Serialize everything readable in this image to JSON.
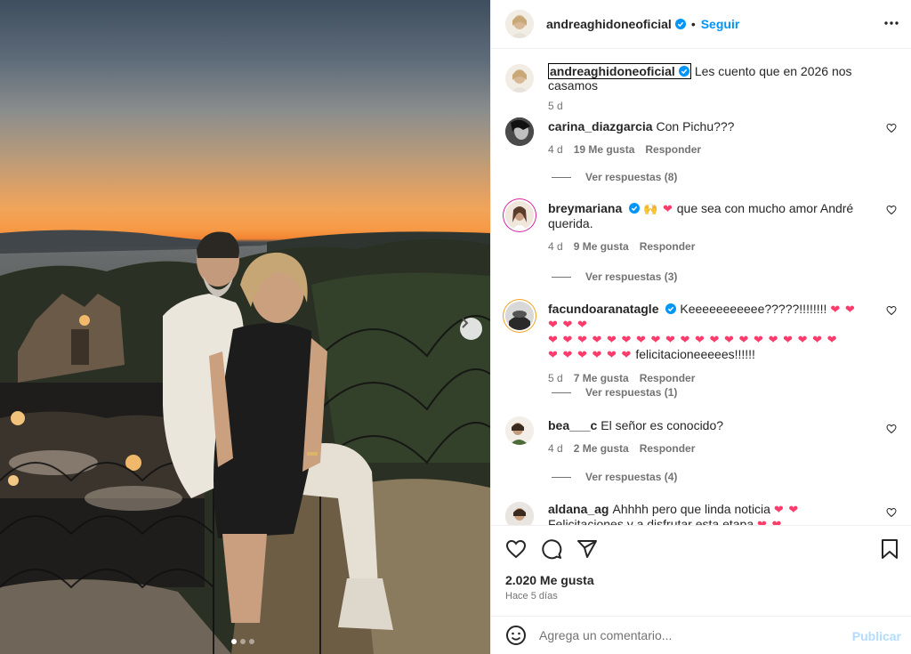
{
  "post": {
    "author": "andreaghidoneoficial",
    "follow_label": "Seguir",
    "caption": "Les cuento que en 2026 nos casamos",
    "caption_time": "5 d",
    "likes": "2.020 Me gusta",
    "posted": "Hace 5 días",
    "carousel": {
      "total": 3,
      "current": 1
    }
  },
  "comments": [
    {
      "user": "carina_diazgarcia",
      "text": "Con Pichu???",
      "time": "4 d",
      "likes": "19 Me gusta",
      "reply": "Responder",
      "replies": "Ver respuestas (8)"
    },
    {
      "user": "breymariana",
      "emoji_lead": "🙌 ❤",
      "text": "que sea con mucho amor André querida.",
      "time": "4 d",
      "likes": "9 Me gusta",
      "reply": "Responder",
      "replies": "Ver respuestas (3)"
    },
    {
      "user": "facundoaranatagle",
      "text": "Keeeeeeeeeee?????!!!!!!!!",
      "emoji_a": "❤ ❤ ❤ ❤ ❤",
      "emoji_b": "❤ ❤ ❤ ❤ ❤ ❤ ❤ ❤ ❤ ❤ ❤ ❤ ❤ ❤ ❤ ❤ ❤ ❤ ❤ ❤",
      "emoji_c": "❤ ❤ ❤ ❤ ❤ ❤",
      "text_end": "felicitacioneeeees!!!!!!",
      "time": "5 d",
      "likes": "7 Me gusta",
      "reply": "Responder",
      "replies": "Ver respuestas (1)"
    },
    {
      "user": "bea___c",
      "text": "El señor es conocido?",
      "time": "4 d",
      "likes": "2 Me gusta",
      "reply": "Responder",
      "replies": "Ver respuestas (4)"
    },
    {
      "user": "aldana_ag",
      "text": "Ahhhh pero que linda noticia",
      "emoji": "❤ ❤",
      "text_end": "Felicitaciones y a disfrutar esta etapa",
      "emoji_end": "❤ ❤"
    }
  ],
  "composer": {
    "placeholder": "Agrega un comentario...",
    "publish_label": "Publicar"
  },
  "colors": {
    "accent": "#0095f6",
    "publish_disabled": "#b3dbff",
    "heart": "#ff3b6b",
    "muted": "#737373"
  },
  "icons": [
    "more-options-icon",
    "like-icon",
    "comment-icon",
    "share-icon",
    "save-icon",
    "emoji-icon",
    "chevron-right-icon",
    "verified-badge-icon"
  ]
}
